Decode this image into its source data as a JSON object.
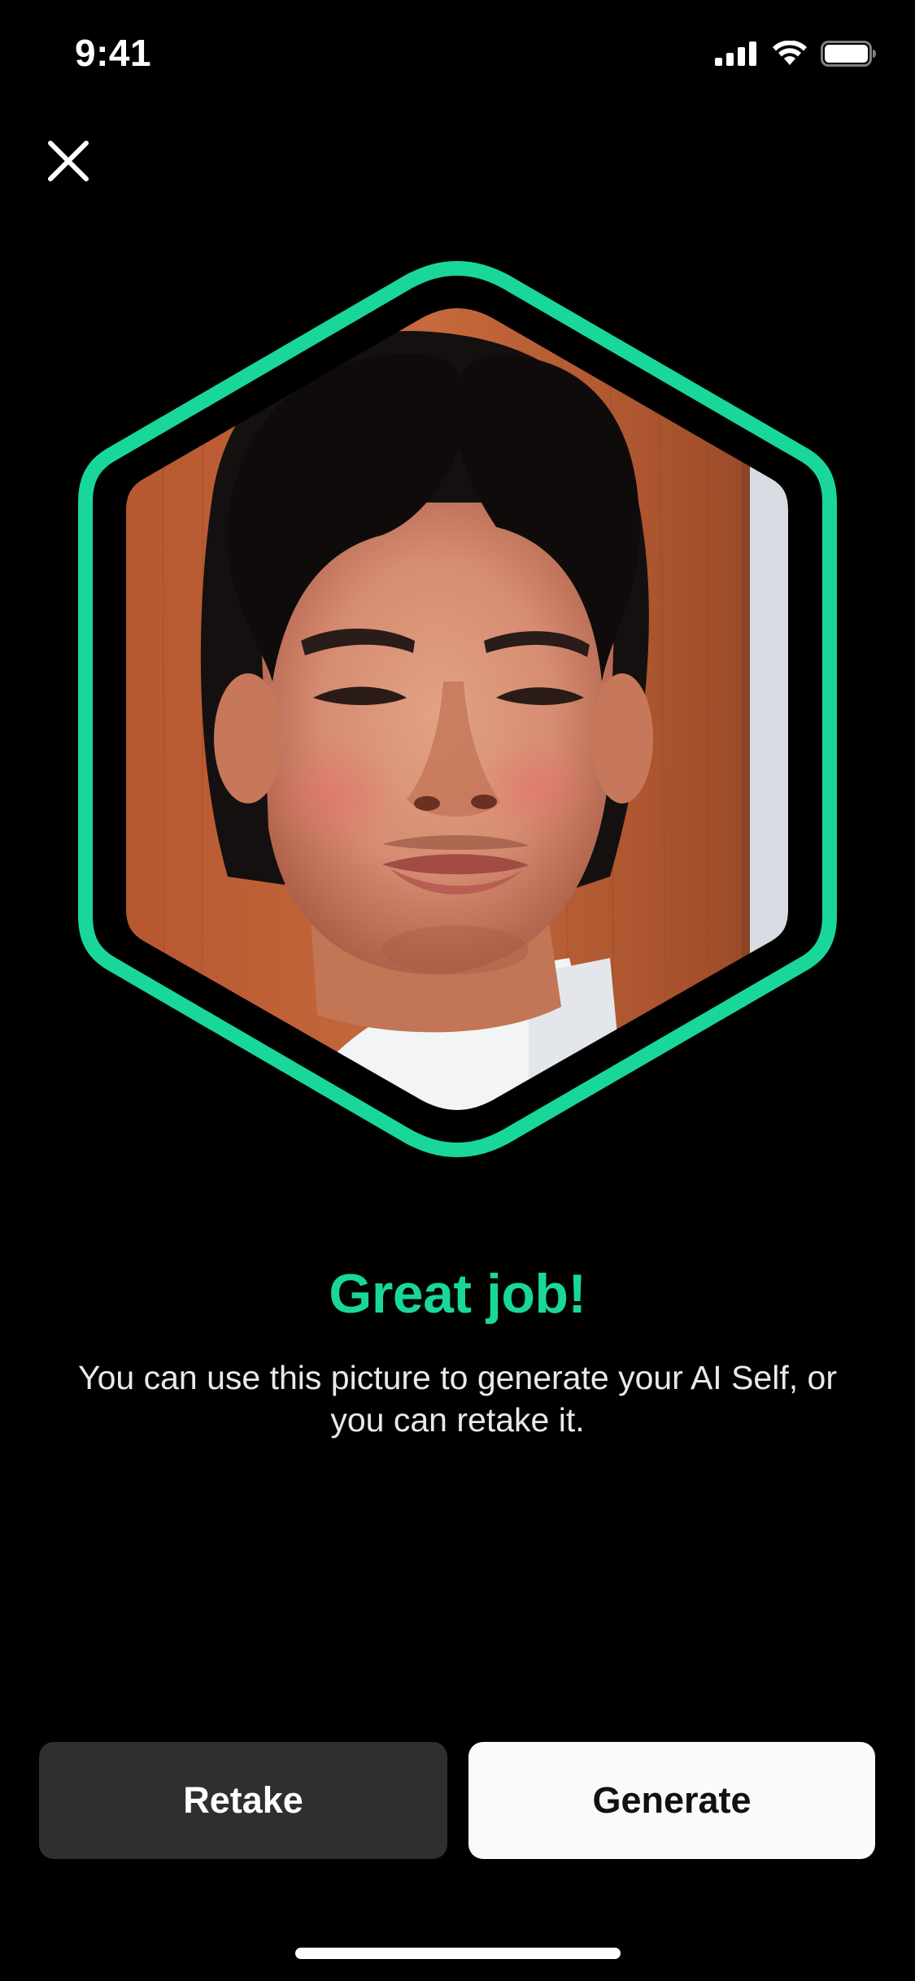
{
  "status_bar": {
    "time": "9:41",
    "icons": [
      "cellular-signal-icon",
      "wifi-icon",
      "battery-icon"
    ]
  },
  "header": {
    "close_icon": "close-icon"
  },
  "photo": {
    "frame_color": "#19d79a",
    "shape": "hexagon"
  },
  "result": {
    "headline": "Great job!",
    "message": "You can use this picture to generate your AI Self, or you can retake it."
  },
  "actions": {
    "retake_label": "Retake",
    "generate_label": "Generate"
  },
  "colors": {
    "accent": "#19d79a",
    "background": "#000000",
    "secondary_button": "#2f2f2f",
    "primary_button": "#fafafa"
  }
}
